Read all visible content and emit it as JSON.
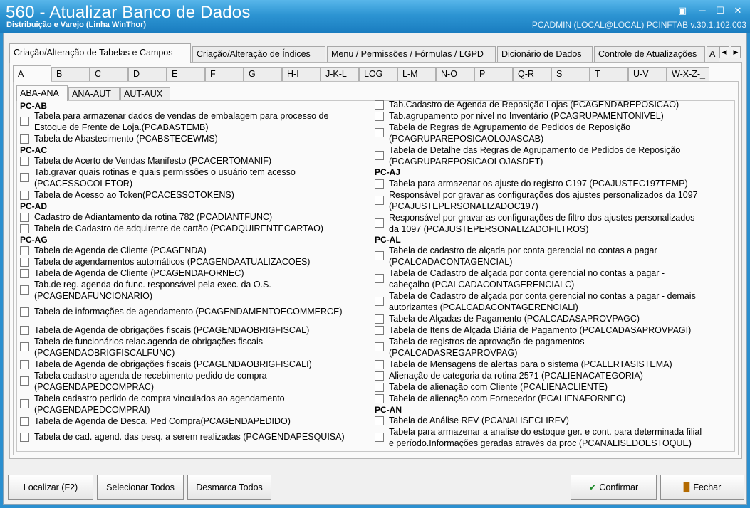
{
  "window": {
    "title": "560 - Atualizar Banco de Dados",
    "subtitle": "Distribuição e Varejo (Linha WinThor)",
    "session": "PCADMIN (LOCAL@LOCAL)   PCINFTAB  v.30.1.102.003"
  },
  "tabs_main": [
    "Criação/Alteração de Tabelas e Campos",
    "Criação/Alteração de Índices",
    "Menu / Permissões / Fórmulas / LGPD",
    "Dicionário de Dados",
    "Controle de Atualizações",
    "A"
  ],
  "tabs_letters": [
    "A",
    "B",
    "C",
    "D",
    "E",
    "F",
    "G",
    "H-I",
    "J-K-L",
    "LOG",
    "L-M",
    "N-O",
    "P",
    "Q-R",
    "S",
    "T",
    "U-V",
    "W-X-Z-_"
  ],
  "tabs_sub": [
    "ABA-ANA",
    "ANA-AUT",
    "AUT-AUX"
  ],
  "left": {
    "groups": [
      "PC-AB",
      "PC-AC",
      "PC-AD",
      "PC-AG"
    ],
    "items": [
      [
        "Tabela para armazenar dados de vendas de embalagem para processo de",
        "Estoque de Frente de Loja.(PCABASTEMB)"
      ],
      [
        "Tabela de Abastecimento (PCABSTECEWMS)"
      ],
      [
        "Tabela de Acerto de Vendas Manifesto (PCACERTOMANIF)"
      ],
      [
        "Tab.gravar quais rotinas e quais permissões o usuário tem acesso",
        "(PCACESSOCOLETOR)"
      ],
      [
        "Tabela de Acesso ao Token(PCACESSOTOKENS)"
      ],
      [
        "Cadastro de Adiantamento da rotina 782 (PCADIANTFUNC)"
      ],
      [
        "Tabela de Cadastro de adquirente de cartão (PCADQUIRENTECARTAO)"
      ],
      [
        "Tabela  de Agenda de Cliente (PCAGENDA)"
      ],
      [
        "Tabela de agendamentos automáticos (PCAGENDAATUALIZACOES)"
      ],
      [
        "Tabela  de Agenda de Cliente (PCAGENDAFORNEC)"
      ],
      [
        "Tab.de reg. agenda do func. responsável pela exec. da O.S.",
        "(PCAGENDAFUNCIONARIO)"
      ],
      [
        "Tabela de informações de agendamento (PCAGENDAMENTOECOMMERCE)"
      ],
      [
        "Tabela de Agenda de obrigações fiscais (PCAGENDAOBRIGFISCAL)"
      ],
      [
        "Tabela de funcionários relac.agenda de obrigações fiscais",
        "(PCAGENDAOBRIGFISCALFUNC)"
      ],
      [
        "Tabela de Agenda de obrigações fiscais (PCAGENDAOBRIGFISCALI)"
      ],
      [
        "Tabela cadastro agenda de recebimento pedido de compra",
        "(PCAGENDAPEDCOMPRAC)"
      ],
      [
        "Tabela cadastro pedido de compra vinculados ao agendamento",
        "(PCAGENDAPEDCOMPRAI)"
      ],
      [
        "Tabela  de Agenda de Desca. Ped Compra(PCAGENDAPEDIDO)"
      ],
      [
        "Tabela de cad. agend. das pesq. a serem realizadas (PCAGENDAPESQUISA)"
      ]
    ]
  },
  "right": {
    "groups": [
      "PC-AJ",
      "PC-AL",
      "PC-AN"
    ],
    "items": [
      [
        "Tab.Cadastro de Agenda de Reposição Lojas (PCAGENDAREPOSICAO)"
      ],
      [
        "Tab.agrupamento por nivel no Inventário (PCAGRUPAMENTONIVEL)"
      ],
      [
        "Tabela de Regras de Agrupamento de Pedidos de Reposição",
        "(PCAGRUPAREPOSICAOLOJASCAB)"
      ],
      [
        "Tabela de Detalhe das Regras de Agrupamento de Pedidos de Reposição",
        "(PCAGRUPAREPOSICAOLOJASDET)"
      ],
      [
        "Tabela para armazenar os ajuste do registro C197 (PCAJUSTEC197TEMP)"
      ],
      [
        "Responsável por gravar as configurações dos ajustes personalizados da 1097",
        "(PCAJUSTEPERSONALIZADOC197)"
      ],
      [
        "Responsável por gravar as configurações de filtro dos ajustes personalizados",
        "da 1097 (PCAJUSTEPERSONALIZADOFILTROS)"
      ],
      [
        "Tabela de cadastro de alçada por conta gerencial no contas a pagar",
        "(PCALCADACONTAGENCIAL)"
      ],
      [
        "Tabela de Cadastro de alçada por conta gerencial no contas a pagar -",
        "cabeçalho (PCALCADACONTAGERENCIALC)"
      ],
      [
        "Tabela de Cadastro de alçada por conta gerencial no contas a pagar - demais",
        "autorizantes (PCALCADACONTAGERENCIALI)"
      ],
      [
        "Tabela de Alçadas de Pagamento (PCALCADASAPROVPAGC)"
      ],
      [
        "Tabela de Itens de Alçada Diária de Pagamento (PCALCADASAPROVPAGI)"
      ],
      [
        "Tabela de registros de aprovação de pagamentos",
        "(PCALCADASREGAPROVPAG)"
      ],
      [
        "Tabela de Mensagens de alertas para o sistema (PCALERTASISTEMA)"
      ],
      [
        "Alienação de categoria da rotina 2571 (PCALIENACATEGORIA)"
      ],
      [
        "Tabela de alienação com Cliente (PCALIENACLIENTE)"
      ],
      [
        "Tabela de alienação com Fornecedor (PCALIENAFORNEC)"
      ],
      [
        "Tabela de Análise RFV (PCANALISECLIRFV)"
      ],
      [
        "Tabela para armazenar a analise do estoque ger. e cont. para determinada filial",
        "e período.Informações geradas através da proc (PCANALISEDOESTOQUE)"
      ]
    ]
  },
  "buttons": {
    "localizar": "Localizar (F2)",
    "selecionar": "Selecionar Todos",
    "desmarcar": "Desmarca Todos",
    "confirmar": "Confirmar",
    "fechar": "Fechar"
  },
  "colors": {
    "title_bar": "#2d95d3",
    "check_icon": "#1f8a2a"
  }
}
